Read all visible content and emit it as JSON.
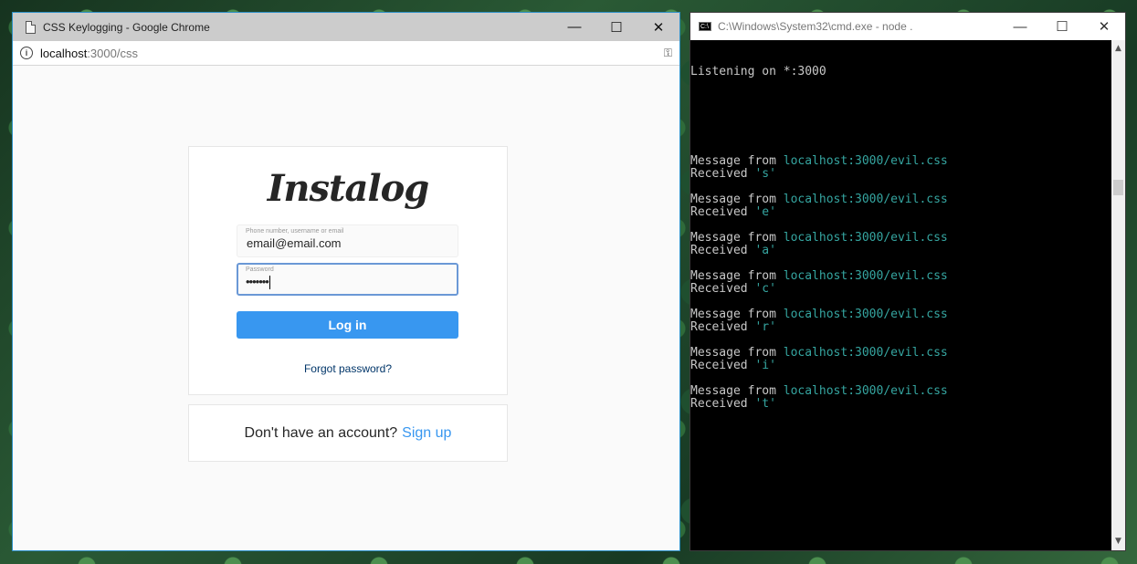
{
  "browser": {
    "window_title": "CSS Keylogging - Google Chrome",
    "url_host": "localhost",
    "url_path": ":3000/css",
    "controls": {
      "minimize": "—",
      "maximize": "☐",
      "close": "✕"
    }
  },
  "login": {
    "logo": "Instalog",
    "username_label": "Phone number, username or email",
    "username_value": "email@email.com",
    "password_label": "Password",
    "password_value": "•••••••",
    "login_button": "Log in",
    "forgot_password": "Forgot password?",
    "signup_prompt": "Don't have an account?",
    "signup_link": "Sign up"
  },
  "console": {
    "window_title": "C:\\Windows\\System32\\cmd.exe - node  .",
    "icon_text": "C:\\",
    "listening": "Listening on *:3000",
    "messages": [
      {
        "from_label": "Message from",
        "source": "localhost:3000/evil.css",
        "received_label": "Received",
        "char": "'s'"
      },
      {
        "from_label": "Message from",
        "source": "localhost:3000/evil.css",
        "received_label": "Received",
        "char": "'e'"
      },
      {
        "from_label": "Message from",
        "source": "localhost:3000/evil.css",
        "received_label": "Received",
        "char": "'a'"
      },
      {
        "from_label": "Message from",
        "source": "localhost:3000/evil.css",
        "received_label": "Received",
        "char": "'c'"
      },
      {
        "from_label": "Message from",
        "source": "localhost:3000/evil.css",
        "received_label": "Received",
        "char": "'r'"
      },
      {
        "from_label": "Message from",
        "source": "localhost:3000/evil.css",
        "received_label": "Received",
        "char": "'i'"
      },
      {
        "from_label": "Message from",
        "source": "localhost:3000/evil.css",
        "received_label": "Received",
        "char": "'t'"
      }
    ],
    "controls": {
      "minimize": "—",
      "maximize": "☐",
      "close": "✕"
    }
  }
}
